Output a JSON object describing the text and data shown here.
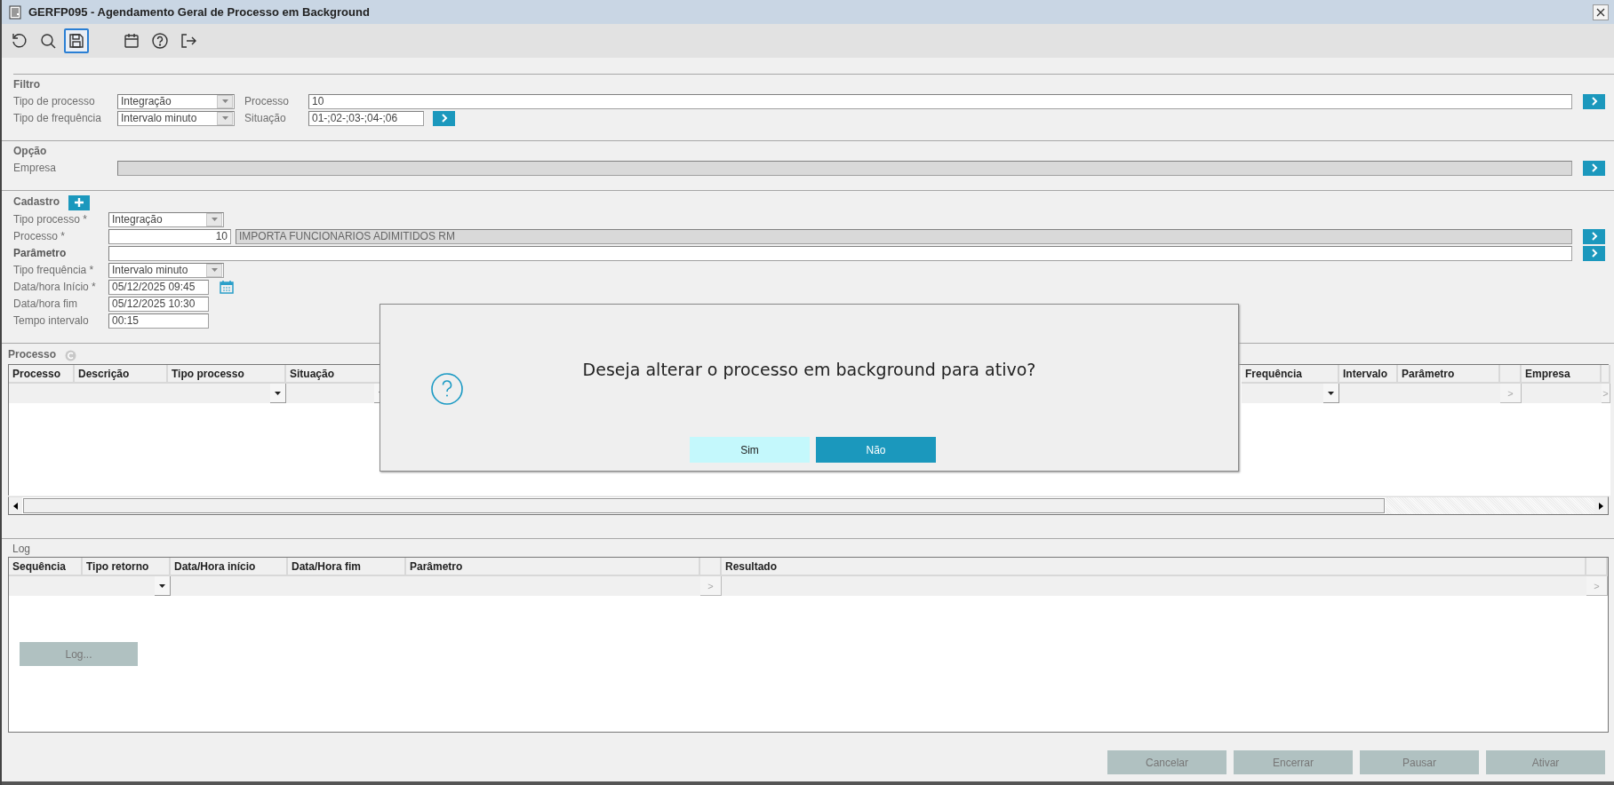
{
  "window": {
    "title": "GERFP095 - Agendamento Geral de Processo em Background"
  },
  "toolbar_buttons": [
    {
      "selected": false
    },
    {
      "selected": false
    },
    {
      "selected": true
    },
    {
      "selected": false
    },
    {
      "selected": false
    },
    {
      "selected": false
    }
  ],
  "filtro": {
    "title": "Filtro",
    "tipo_processo": {
      "label": "Tipo de processo",
      "value": "Integração"
    },
    "tipo_frequencia": {
      "label": "Tipo de frequência",
      "value": "Intervalo minuto"
    },
    "processo": {
      "label": "Processo",
      "value": "10"
    },
    "situacao": {
      "label": "Situação",
      "value": "01-;02-;03-;04-;06"
    }
  },
  "opcao": {
    "title": "Opção",
    "empresa": {
      "label": "Empresa",
      "disabled": true
    }
  },
  "cadastro": {
    "title": "Cadastro",
    "tipo_processo": {
      "label": "Tipo processo *",
      "value": "Integração"
    },
    "processo": {
      "label": "Processo *",
      "value": "10",
      "description": "IMPORTA FUNCIONARIOS ADIMITIDOS RM"
    },
    "parametro": {
      "label": "Parâmetro"
    },
    "tipo_frequencia": {
      "label": "Tipo frequência *",
      "value": "Intervalo minuto"
    },
    "data_inicio": {
      "label": "Data/hora Início *",
      "value": "05/12/2025 09:45"
    },
    "data_fim": {
      "label": "Data/hora fim",
      "value": "05/12/2025 10:30"
    },
    "tempo_intervalo": {
      "label": "Tempo intervalo",
      "value": "00:15"
    }
  },
  "processo_table": {
    "title": "Processo",
    "columns": [
      {
        "label": "Processo",
        "kind": "text"
      },
      {
        "label": "Descrição",
        "kind": "text"
      },
      {
        "label": "Tipo processo",
        "kind": "combo"
      },
      {
        "label": "Situação",
        "kind": "combo"
      },
      {
        "kind": "hidden"
      },
      {
        "label": "Frequência",
        "kind": "combo"
      },
      {
        "label": "Intervalo",
        "kind": "text"
      },
      {
        "label": "Parâmetro",
        "kind": "text"
      },
      {
        "kind": "lookup",
        "button": ">"
      },
      {
        "label": "Empresa",
        "kind": "text"
      },
      {
        "kind": "lookup",
        "button": ">"
      }
    ]
  },
  "log_table": {
    "title": "Log",
    "columns": [
      {
        "label": "Sequência",
        "kind": "text"
      },
      {
        "label": "Tipo retorno",
        "kind": "combo"
      },
      {
        "label": "Data/Hora início",
        "kind": "text"
      },
      {
        "label": "Data/Hora fim",
        "kind": "text"
      },
      {
        "label": "Parâmetro",
        "kind": "text"
      },
      {
        "kind": "lookup",
        "button": ">"
      },
      {
        "label": "Resultado",
        "kind": "text"
      },
      {
        "kind": "lookup",
        "button": ">"
      }
    ],
    "log_button": {
      "label": "Log...",
      "disabled": true
    }
  },
  "actions": [
    {
      "label": "Cancelar",
      "disabled": true
    },
    {
      "label": "Encerrar",
      "disabled": true
    },
    {
      "label": "Pausar",
      "disabled": true
    },
    {
      "label": "Ativar",
      "disabled": true
    }
  ],
  "dialog": {
    "message": "Deseja alterar o processo em background para ativo?",
    "buttons": [
      {
        "label": "Sim",
        "selected": false
      },
      {
        "label": "Não",
        "selected": true
      }
    ]
  }
}
